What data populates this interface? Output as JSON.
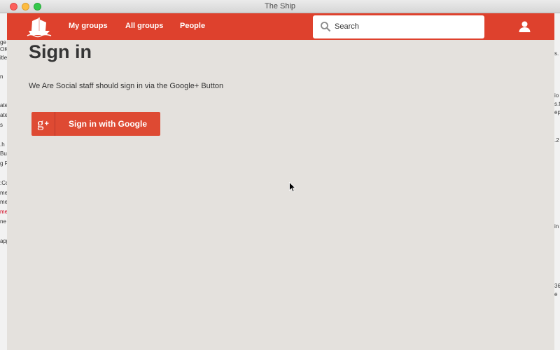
{
  "window": {
    "title": "The Ship"
  },
  "nav": {
    "links": [
      "My groups",
      "All groups",
      "People"
    ],
    "search_placeholder": "Search"
  },
  "main": {
    "title": "Sign in",
    "intro": "We Are Social staff should sign in via the Google+ Button",
    "google_button": {
      "icon_text": "g",
      "icon_plus": "+",
      "label": "Sign in with Google"
    }
  },
  "colors": {
    "brand": "#de412d",
    "button": "#de4a33",
    "background": "#e4e1dd"
  },
  "background_fragments": {
    "left": [
      "ge",
      "OK",
      "itle",
      "n",
      "ate",
      "ate",
      "s",
      ".h",
      "Bui",
      "g F",
      ":Co",
      "me",
      "me",
      "me",
      "ne",
      "app"
    ],
    "right": [
      "s.",
      "io",
      "s.t",
      "ep",
      ".2",
      "in",
      "36",
      "e"
    ]
  }
}
